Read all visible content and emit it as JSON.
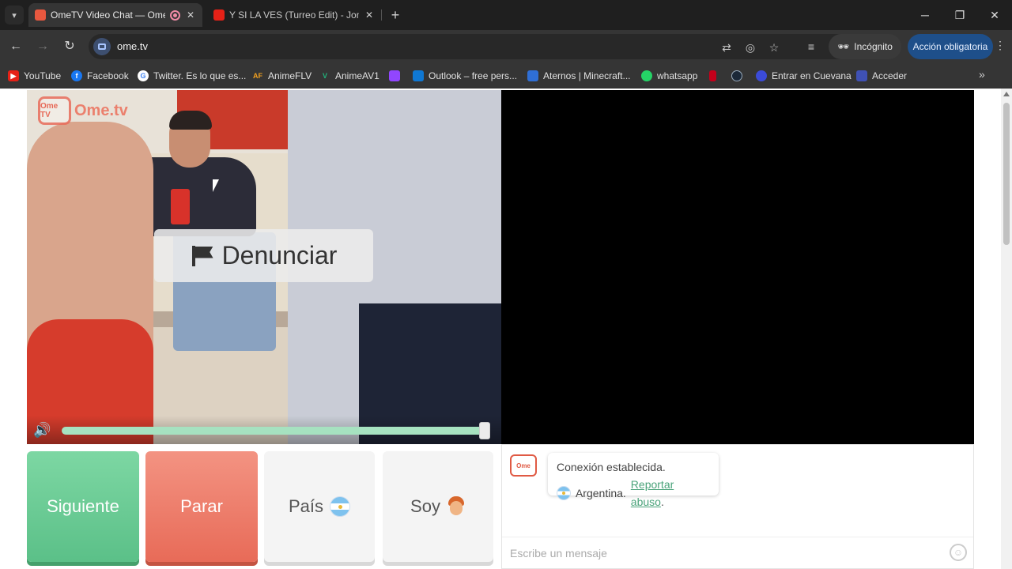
{
  "browser": {
    "tabs": [
      {
        "title": "OmeTV Video Chat — Ome",
        "active": true
      },
      {
        "title": "Y SI LA VES (Turreo Edit) - Jona",
        "active": false
      }
    ],
    "url": "ome.tv",
    "incognito_label": "Incógnito",
    "action_label": "Acción obligatoria",
    "bookmarks": [
      {
        "label": "YouTube",
        "color": "#e62117"
      },
      {
        "label": "Facebook",
        "color": "#1877f2"
      },
      {
        "label": "Twitter. Es lo que es...",
        "color": "#4285f4"
      },
      {
        "label": "AnimeFLV",
        "color": "#f0a020"
      },
      {
        "label": "AnimeAV1",
        "color": "#22b07a"
      },
      {
        "label": "",
        "color": "#9146ff"
      },
      {
        "label": "Outlook – free pers...",
        "color": "#0f78d4"
      },
      {
        "label": "Aternos | Minecraft...",
        "color": "#2f6fd6"
      },
      {
        "label": "whatsapp",
        "color": "#25d366"
      },
      {
        "label": "",
        "color": "#c4001a"
      },
      {
        "label": "",
        "color": "#1b2838"
      },
      {
        "label": "Entrar en Cuevana",
        "color": "#3b4bd8"
      },
      {
        "label": "Acceder",
        "color": "#3f51b5"
      }
    ]
  },
  "video": {
    "logo_text": "Ome.tv",
    "logo_tv_text": "Ome TV",
    "report_label": "Denunciar",
    "volume_level": 1.0
  },
  "controls": {
    "next_label": "Siguiente",
    "stop_label": "Parar",
    "country_label": "País",
    "soy_label": "Soy"
  },
  "chat": {
    "connection_text": "Conexión establecida.",
    "country_text": "Argentina.",
    "report_link": "Reportar abuso",
    "report_punct": ".",
    "input_placeholder": "Escribe un mensaje"
  },
  "colors": {
    "next": "#6bcb95",
    "stop": "#ec7b68",
    "accent_link": "#4aa37a"
  }
}
